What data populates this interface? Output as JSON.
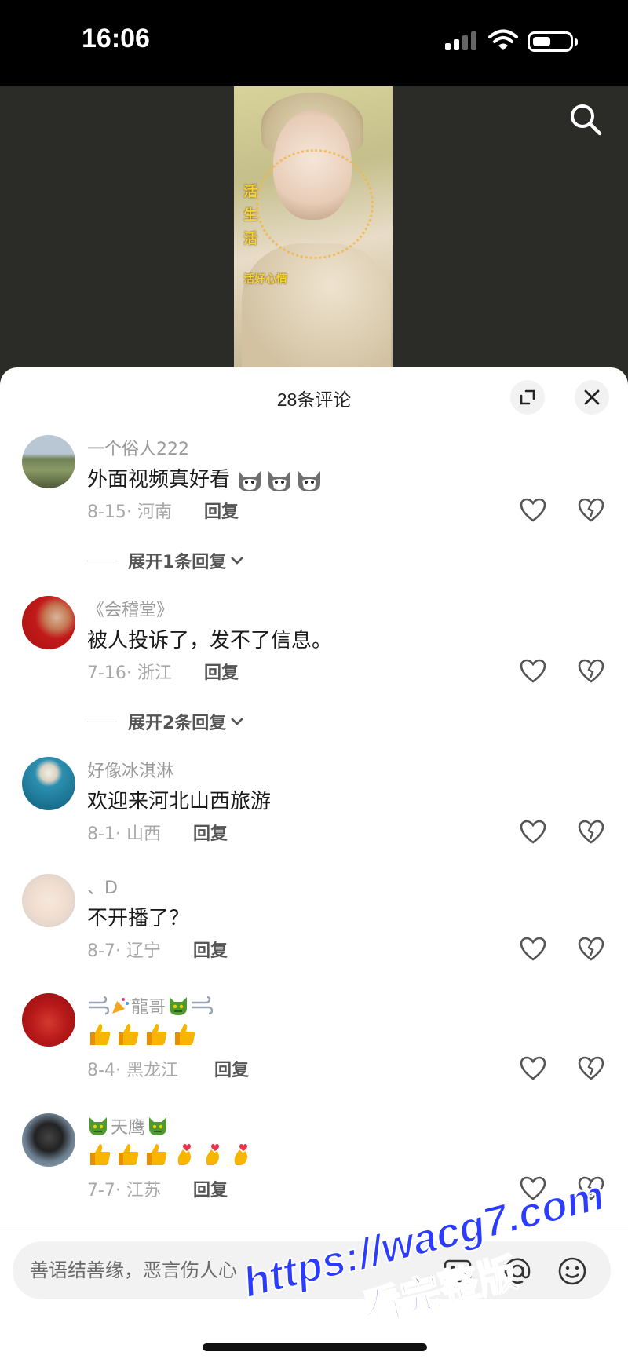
{
  "status_bar": {
    "time": "16:06"
  },
  "comments_panel": {
    "title": "28条评论",
    "comments": [
      {
        "name": "一个俗人222",
        "text": "外面视频真好看",
        "text_emoji": [
          "husky-emoji",
          "husky-emoji",
          "husky-emoji"
        ],
        "date": "8-15",
        "location": "河南",
        "reply": "回复",
        "expand": "展开1条回复"
      },
      {
        "name": "《会稽堂》",
        "text": "被人投诉了，发不了信息。",
        "date": "7-16",
        "location": "浙江",
        "reply": "回复",
        "expand": "展开2条回复"
      },
      {
        "name": "好像冰淇淋",
        "text": "欢迎来河北山西旅游",
        "date": "8-1",
        "location": "山西",
        "reply": "回复"
      },
      {
        "name": "、D",
        "text": "不开播了？",
        "date": "8-7",
        "location": "辽宁",
        "reply": "回复"
      },
      {
        "name": "龍哥",
        "name_emoji": [
          "wind-emoji",
          "party-popper-emoji",
          "dragon-emoji",
          "wind-emoji"
        ],
        "text_emoji": [
          "thumbs-up",
          "thumbs-up",
          "thumbs-up",
          "thumbs-up"
        ],
        "date": "8-4",
        "location": "黑龙江",
        "reply": "回复"
      },
      {
        "name": "天鹰",
        "name_emoji": [
          "dragon-emoji",
          "dragon-emoji"
        ],
        "text_emoji": [
          "thumbs-up",
          "thumbs-up",
          "thumbs-up",
          "finger-heart",
          "finger-heart",
          "finger-heart"
        ],
        "date": "7-7",
        "location": "江苏",
        "reply": "回复"
      }
    ]
  },
  "video": {
    "overlay_text": [
      "活",
      "生",
      "活",
      "活好心情"
    ]
  },
  "input": {
    "placeholder": "善语结善缘，恶言伤人心"
  },
  "watermark": {
    "line1": "https://wacg7.com",
    "line2": "看完整版"
  },
  "colors": {
    "watermark": "#2b3bff",
    "thumb_emoji": "#f7b500"
  }
}
